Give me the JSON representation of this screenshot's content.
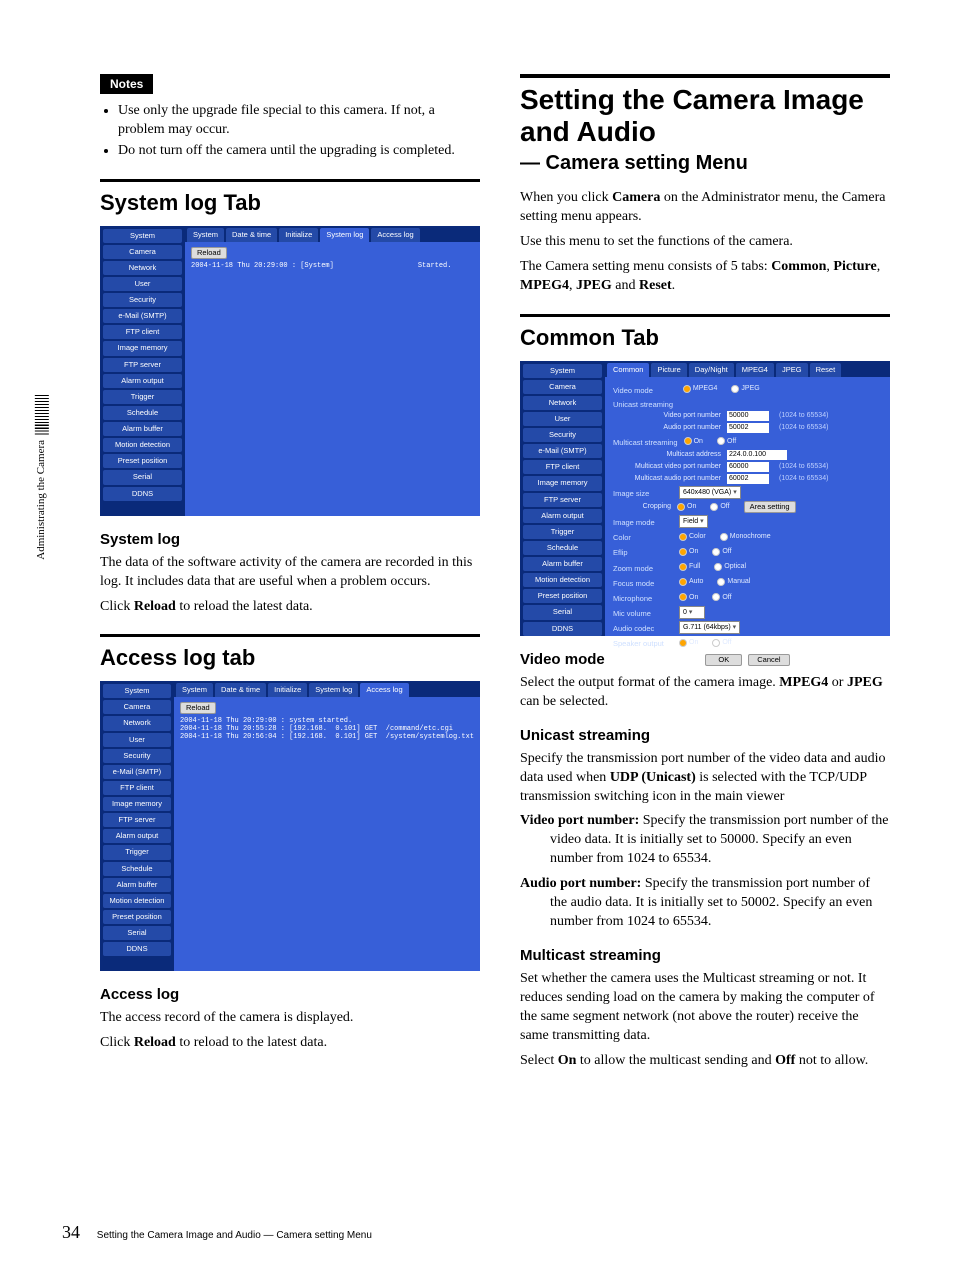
{
  "page_number": "34",
  "footer": "Setting the Camera Image and Audio — Camera setting Menu",
  "side_label": "Administrating the Camera",
  "notes_label": "Notes",
  "notes": [
    "Use only the upgrade file special to this camera. If not, a problem may occur.",
    "Do not turn off the camera until the upgrading is completed."
  ],
  "nav_items": [
    "System",
    "Camera",
    "Network",
    "User",
    "Security",
    "e-Mail (SMTP)",
    "FTP client",
    "Image memory",
    "FTP server",
    "Alarm output",
    "Trigger",
    "Schedule",
    "Alarm buffer",
    "Motion detection",
    "Preset position",
    "Serial",
    "DDNS"
  ],
  "syslog": {
    "heading": "System log Tab",
    "tabs": [
      "System",
      "Date & time",
      "Initialize",
      "System log",
      "Access log"
    ],
    "active_tab": "System log",
    "reload_label": "Reload",
    "log_lines": [
      "2004-11-18 Thu 20:29:00 : [System]                    Started."
    ],
    "sub_heading": "System log",
    "body1": "The data of the software activity of the camera are recorded in this log. It includes data that are useful when a problem occurs.",
    "body2_pre": "Click ",
    "body2_b": "Reload",
    "body2_post": " to reload the latest data."
  },
  "accesslog": {
    "heading": "Access log tab",
    "tabs": [
      "System",
      "Date & time",
      "Initialize",
      "System log",
      "Access log"
    ],
    "active_tab": "Access log",
    "reload_label": "Reload",
    "log_lines": [
      "2004-11-18 Thu 20:29:00 : system started.",
      "2004-11-18 Thu 20:55:28 : [192.168.  0.101] GET  /command/etc.cgi",
      "2004-11-18 Thu 20:56:04 : [192.168.  0.101] GET  /system/systemlog.txt"
    ],
    "sub_heading": "Access log",
    "body1": "The access record of the camera is displayed.",
    "body2_pre": "Click ",
    "body2_b": "Reload",
    "body2_post": " to reload to the latest data."
  },
  "right": {
    "title": "Setting the Camera Image and Audio",
    "subtitle": "— Camera setting Menu",
    "p1_pre": "When you click ",
    "p1_b": "Camera",
    "p1_post": " on the Administrator menu, the Camera setting menu appears.",
    "p2": "Use this menu to set the functions of the camera.",
    "p3_pre": "The Camera setting menu consists of 5 tabs: ",
    "p3_b1": "Common",
    "p3_mid1": ", ",
    "p3_b2": "Picture",
    "p3_mid2": ", ",
    "p3_b3": "MPEG4",
    "p3_mid3": ", ",
    "p3_b4": "JPEG",
    "p3_mid4": " and ",
    "p3_b5": "Reset",
    "p3_end": "."
  },
  "common": {
    "heading": "Common Tab",
    "tabs": [
      "Common",
      "Picture",
      "Day/Night",
      "MPEG4",
      "JPEG",
      "Reset"
    ],
    "active_tab": "Common",
    "video_mode_label": "Video mode",
    "video_mode_opts": [
      "MPEG4",
      "JPEG"
    ],
    "unicast_label": "Unicast streaming",
    "video_port_label": "Video port number",
    "video_port_val": "50000",
    "audio_port_label": "Audio port number",
    "audio_port_val": "50002",
    "port_hint": "(1024 to 65534)",
    "multicast_label": "Multicast streaming",
    "on": "On",
    "off": "Off",
    "multicast_addr_label": "Multicast address",
    "multicast_addr_val": "224.0.0.100",
    "multicast_vport_label": "Multicast video port number",
    "multicast_vport_val": "60000",
    "multicast_aport_label": "Multicast audio port number",
    "multicast_aport_val": "60002",
    "image_size_label": "Image size",
    "image_size_val": "640x480 (VGA)",
    "cropping_label": "Cropping",
    "area_setting_label": "Area setting",
    "image_mode_label": "Image mode",
    "image_mode_val": "Field",
    "color_label": "Color",
    "color_opts": [
      "Color",
      "Monochrome"
    ],
    "eflip_label": "Eflip",
    "zoom_label": "Zoom mode",
    "zoom_opts": [
      "Full",
      "Optical"
    ],
    "focus_label": "Focus mode",
    "focus_opts": [
      "Auto",
      "Manual"
    ],
    "mic_label": "Microphone",
    "mic_vol_label": "Mic volume",
    "mic_vol_val": "0",
    "codec_label": "Audio codec",
    "codec_val": "G.711 (64kbps)",
    "speaker_label": "Speaker output",
    "ok": "OK",
    "cancel": "Cancel"
  },
  "text": {
    "video_mode_h": "Video mode",
    "video_mode_p_pre": "Select the output format of the camera image. ",
    "video_mode_b1": "MPEG4",
    "video_mode_mid": " or ",
    "video_mode_b2": "JPEG",
    "video_mode_post": " can be selected.",
    "unicast_h": "Unicast streaming",
    "unicast_p_pre": "Specify the transmission port number of the video data and audio data used when ",
    "unicast_b": "UDP (Unicast)",
    "unicast_post": " is selected with the TCP/UDP transmission switching icon in the main viewer",
    "vpn_b": "Video port number:",
    "vpn_t": " Specify the transmission port number of the video data. It is initially set to 50000. Specify an even number from 1024 to 65534.",
    "apn_b": "Audio port number:",
    "apn_t": " Specify the transmission port number of the audio data. It is initially set to 50002. Specify an even number from 1024 to 65534.",
    "multicast_h": "Multicast streaming",
    "multicast_p1": "Set whether the camera uses the Multicast streaming or not. It reduces sending load on the camera by making the computer of the same segment network (not above the router) receive the same transmitting data.",
    "multicast_p2_pre": "Select ",
    "multicast_on": "On",
    "multicast_mid": " to allow the multicast sending and ",
    "multicast_off": "Off",
    "multicast_post": "  not to allow."
  }
}
